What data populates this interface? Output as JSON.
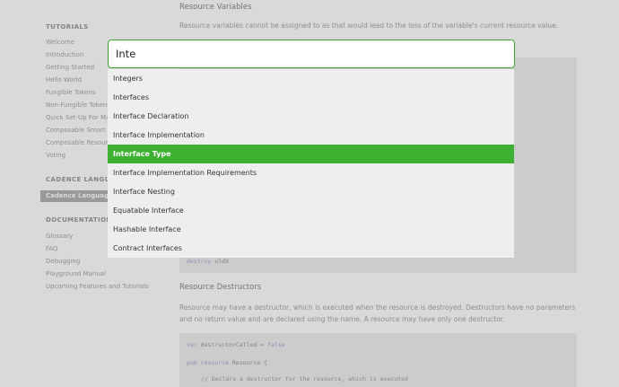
{
  "search": {
    "value": "Inte",
    "results": [
      "Integers",
      "Interfaces",
      "Interface Declaration",
      "Interface Implementation",
      "Interface Type",
      "Interface Implementation Requirements",
      "Interface Nesting",
      "Equatable Interface",
      "Hashable Interface",
      "Contract Interfaces"
    ],
    "selected_index": 4
  },
  "sidebar": {
    "tutorials_heading": "TUTORIALS",
    "tutorials": [
      "Welcome",
      "Introduction",
      "Getting Started",
      "Hello World",
      "Fungible Tokens",
      "Non-Fungible Tokens",
      "Quick Set-Up For Marketplace",
      "Composable Smart Contracts",
      "Composable Resources",
      "Voting"
    ],
    "language_heading": "CADENCE LANGUAGE",
    "language_active": "Cadence Language Reference",
    "docs_heading": "DOCUMENTATION",
    "docs": [
      "Glossary",
      "FAQ",
      "Debugging",
      "Playground Manual",
      "Upcoming Features and Tutorials"
    ]
  },
  "main": {
    "section1_title": "Resource Variables",
    "section1_text": "Resource variables cannot be assigned to as that would lead to the loss of the variable's current resource value.",
    "code1": {
      "kw": "destroy",
      "rest": " oldX"
    },
    "section2_title": "Resource Destructors",
    "section2_text": "Resource may have a destructor, which is executed when the resource is destroyed. Destructors have no parameters and no return value and are declared using the name. A resource may have only one destructor.",
    "code2": {
      "line1_kw": "var",
      "line1_rest": " destructorCalled = ",
      "line1_val": "false",
      "line2_kw1": "pub",
      "line2_kw2": "resource",
      "line2_rest": " Resource {",
      "line3_comment": "// Declare a destructor for the resource, which is executed"
    }
  }
}
